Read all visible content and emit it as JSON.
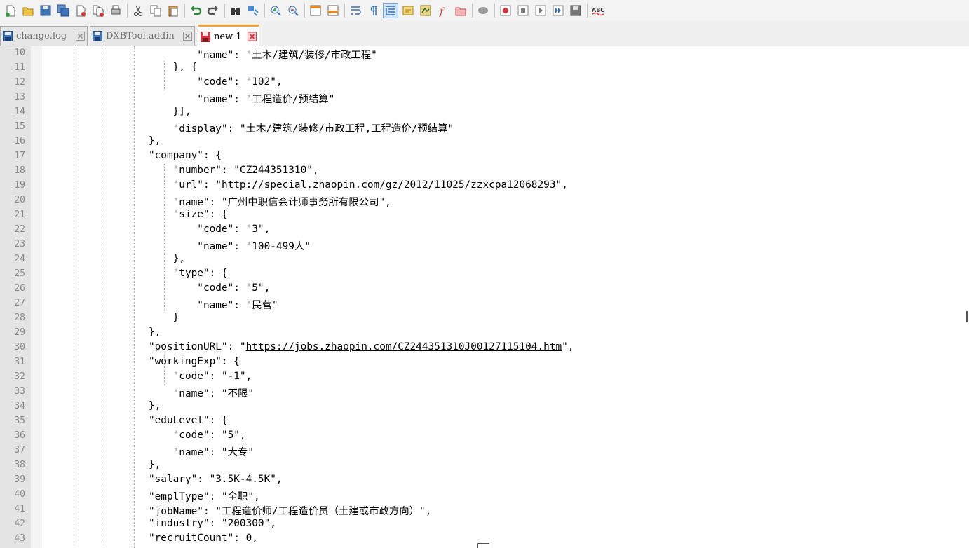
{
  "tabs": [
    {
      "label": "change.log",
      "active": false,
      "saved": true
    },
    {
      "label": "DXBTool.addin",
      "active": false,
      "saved": true
    },
    {
      "label": "new 1",
      "active": true,
      "saved": false
    }
  ],
  "toolbar": {
    "icons": [
      "new-file-icon",
      "open-file-icon",
      "save-icon",
      "save-all-icon",
      "close-icon",
      "close-all-icon",
      "print-icon",
      "cut-icon",
      "copy-icon",
      "paste-icon",
      "undo-icon",
      "redo-icon",
      "find-icon",
      "replace-icon",
      "zoom-in-icon",
      "zoom-out-icon",
      "sync-vertical-icon",
      "sync-horizontal-icon",
      "word-wrap-icon",
      "show-all-characters-icon",
      "indent-guide-icon",
      "user-language-icon",
      "document-map-icon",
      "function-list-icon",
      "folder-as-workspace-icon",
      "monitoring-icon",
      "record-macro-icon",
      "stop-recording-icon",
      "playback-macro-icon",
      "run-macro-multiple-icon",
      "save-macro-icon",
      "spell-check-icon"
    ],
    "spell_label": "ABC"
  },
  "editor": {
    "lines": [
      {
        "n": "10",
        "code": "                    \"name\": \"土木/建筑/装修/市政工程\""
      },
      {
        "n": "11",
        "code": "                }, {"
      },
      {
        "n": "12",
        "code": "                    \"code\": \"102\","
      },
      {
        "n": "13",
        "code": "                    \"name\": \"工程造价/预结算\""
      },
      {
        "n": "14",
        "code": "                }],"
      },
      {
        "n": "15",
        "code": "                \"display\": \"土木/建筑/装修/市政工程,工程造价/预结算\""
      },
      {
        "n": "16",
        "code": "            },"
      },
      {
        "n": "17",
        "code": "            \"company\": {"
      },
      {
        "n": "18",
        "code": "                \"number\": \"CZ244351310\","
      },
      {
        "n": "19",
        "pre": "                \"url\": \"",
        "link": "http://special.zhaopin.com/gz/2012/11025/zzxcpa12068293",
        "post": "\","
      },
      {
        "n": "20",
        "code": "                \"name\": \"广州中职信会计师事务所有限公司\","
      },
      {
        "n": "21",
        "code": "                \"size\": {"
      },
      {
        "n": "22",
        "code": "                    \"code\": \"3\","
      },
      {
        "n": "23",
        "code": "                    \"name\": \"100-499人\""
      },
      {
        "n": "24",
        "code": "                },"
      },
      {
        "n": "25",
        "code": "                \"type\": {"
      },
      {
        "n": "26",
        "code": "                    \"code\": \"5\","
      },
      {
        "n": "27",
        "code": "                    \"name\": \"民营\""
      },
      {
        "n": "28",
        "code": "                }"
      },
      {
        "n": "29",
        "code": "            },"
      },
      {
        "n": "30",
        "pre": "            \"positionURL\": \"",
        "link": "https://jobs.zhaopin.com/CZ244351310J00127115104.htm",
        "post": "\","
      },
      {
        "n": "31",
        "code": "            \"workingExp\": {"
      },
      {
        "n": "32",
        "code": "                \"code\": \"-1\","
      },
      {
        "n": "33",
        "code": "                \"name\": \"不限\""
      },
      {
        "n": "34",
        "code": "            },"
      },
      {
        "n": "35",
        "code": "            \"eduLevel\": {"
      },
      {
        "n": "36",
        "code": "                \"code\": \"5\","
      },
      {
        "n": "37",
        "code": "                \"name\": \"大专\""
      },
      {
        "n": "38",
        "code": "            },"
      },
      {
        "n": "39",
        "code": "            \"salary\": \"3.5K-4.5K\","
      },
      {
        "n": "40",
        "code": "            \"emplType\": \"全职\","
      },
      {
        "n": "41",
        "code": "            \"jobName\": \"工程造价师/工程造价员（土建或市政方向）\","
      },
      {
        "n": "42",
        "code": "            \"industry\": \"200300\","
      },
      {
        "n": "43",
        "code": "            \"recruitCount\": 0,"
      }
    ]
  }
}
